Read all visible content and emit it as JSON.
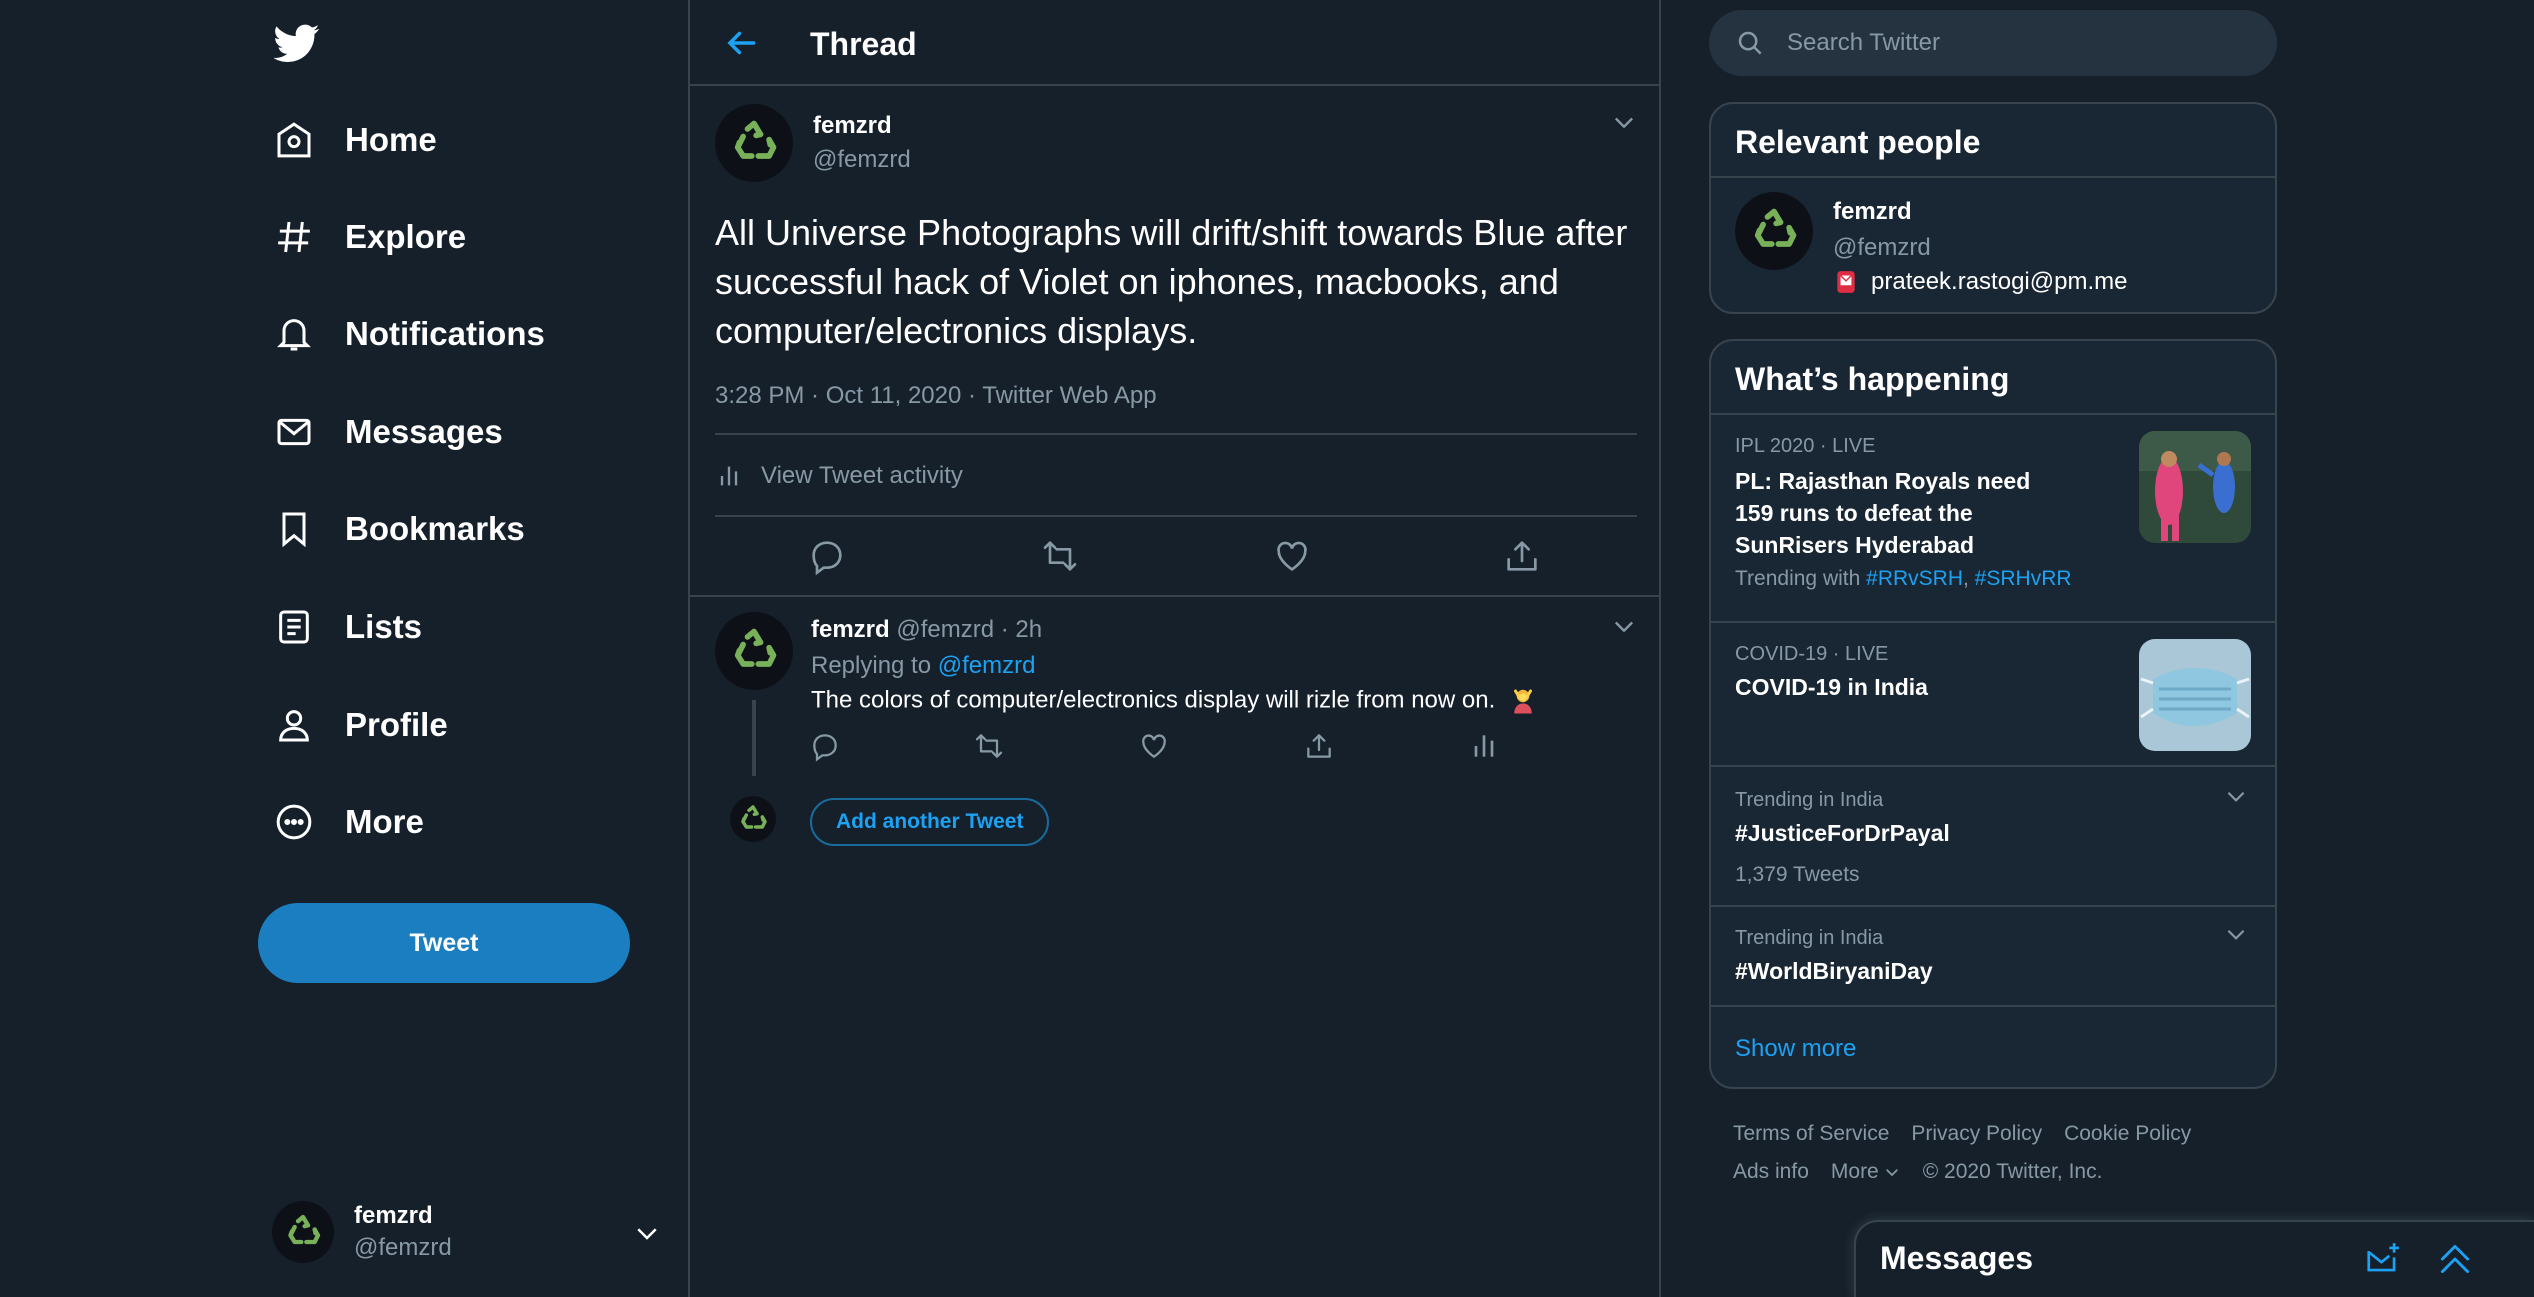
{
  "nav": {
    "items": [
      {
        "label": "Home",
        "icon": "home-icon"
      },
      {
        "label": "Explore",
        "icon": "hashtag-icon"
      },
      {
        "label": "Notifications",
        "icon": "bell-icon"
      },
      {
        "label": "Messages",
        "icon": "envelope-icon"
      },
      {
        "label": "Bookmarks",
        "icon": "bookmark-icon"
      },
      {
        "label": "Lists",
        "icon": "list-icon"
      },
      {
        "label": "Profile",
        "icon": "person-icon"
      },
      {
        "label": "More",
        "icon": "more-circle-icon"
      }
    ],
    "tweet_button": "Tweet"
  },
  "account": {
    "name": "femzrd",
    "handle": "@femzrd"
  },
  "header": {
    "title": "Thread"
  },
  "tweet": {
    "author_name": "femzrd",
    "author_handle": "@femzrd",
    "text": "All Universe Photographs will drift/shift towards Blue after successful hack of Violet on iphones, macbooks, and computer/electronics displays.",
    "meta": "3:28 PM · Oct 11, 2020 · Twitter Web App",
    "activity_label": "View Tweet activity"
  },
  "reply": {
    "author_name": "femzrd",
    "author_handle": "@femzrd",
    "time": "· 2h",
    "replying_prefix": "Replying to",
    "replying_to": "@femzrd",
    "text": "The colors of computer/electronics display will rizle from now on."
  },
  "add_tweet_label": "Add another Tweet",
  "search": {
    "placeholder": "Search Twitter"
  },
  "relevant_people": {
    "title": "Relevant people",
    "name": "femzrd",
    "handle": "@femzrd",
    "email": "prateek.rastogi@pm.me"
  },
  "whats_happening": {
    "title": "What’s happening",
    "trends": [
      {
        "meta": "IPL 2020 · LIVE",
        "title": "PL: Rajasthan Royals need 159 runs to defeat the SunRisers Hyderabad",
        "sub_prefix": "Trending with",
        "tag1": "#RRvSRH",
        "tag_sep": ", ",
        "tag2": "#SRHvRR"
      },
      {
        "meta": "COVID-19 · LIVE",
        "title": "COVID-19 in India"
      },
      {
        "meta": "Trending in India",
        "title": "#JusticeForDrPayal",
        "sub": "1,379 Tweets"
      },
      {
        "meta": "Trending in India",
        "title": "#WorldBiryaniDay"
      }
    ],
    "show_more": "Show more"
  },
  "footer": {
    "links": [
      "Terms of Service",
      "Privacy Policy",
      "Cookie Policy",
      "Ads info",
      "More"
    ],
    "copyright": "© 2020 Twitter, Inc."
  },
  "messages_drawer": {
    "title": "Messages"
  },
  "colors": {
    "background": "#15202b",
    "card": "#192734",
    "border": "#38444d",
    "accent": "#1da1f2",
    "tweet_button": "#1a7ec0",
    "muted": "#8899a6",
    "recycle_green": "#78b159"
  }
}
